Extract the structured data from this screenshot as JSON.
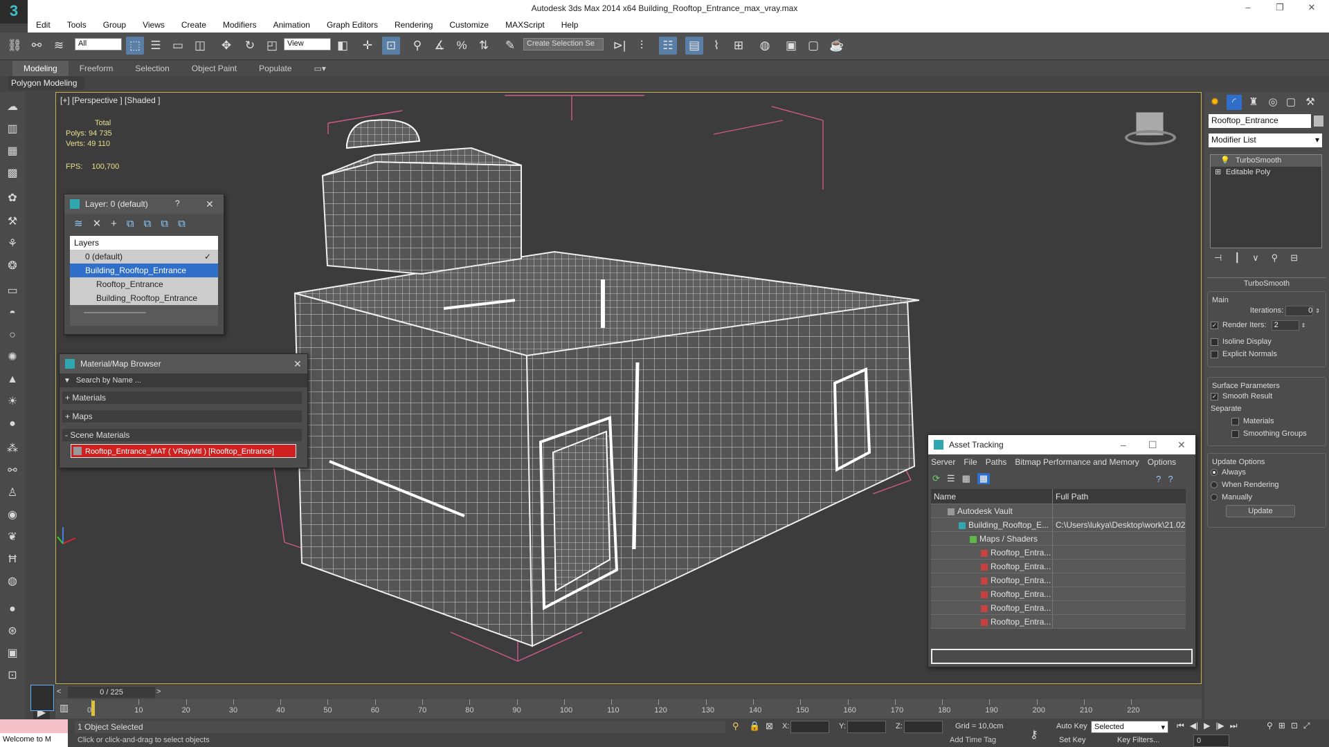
{
  "app": {
    "title": "Autodesk 3ds Max  2014 x64    Building_Rooftop_Entrance_max_vray.max",
    "logo": "3"
  },
  "menu": [
    "Edit",
    "Tools",
    "Group",
    "Views",
    "Create",
    "Modifiers",
    "Animation",
    "Graph Editors",
    "Rendering",
    "Customize",
    "MAXScript",
    "Help"
  ],
  "toolbar": {
    "filter": "All",
    "ref_coord": "View",
    "selection_set": "Create Selection Se"
  },
  "ribbon": {
    "tabs": [
      "Modeling",
      "Freeform",
      "Selection",
      "Object Paint",
      "Populate"
    ],
    "sub_label": "Polygon Modeling"
  },
  "viewport": {
    "label": "[+] [Perspective ] [Shaded ]",
    "stats_total": "Total",
    "polys_label": "Polys:",
    "polys_value": "94 735",
    "verts_label": "Verts:",
    "verts_value": "49 110",
    "fps_label": "FPS:",
    "fps_value": "100,700"
  },
  "layer_panel": {
    "title": "Layer: 0 (default)",
    "help": "?",
    "header": "Layers",
    "items": [
      "0 (default)",
      "Building_Rooftop_Entrance",
      "Rooftop_Entrance",
      "Building_Rooftop_Entrance"
    ]
  },
  "material_browser": {
    "title": "Material/Map Browser",
    "search_placeholder": "Search by Name ...",
    "sections": [
      "+ Materials",
      "+ Maps",
      "- Scene Materials"
    ],
    "scene_material": "Rooftop_Entrance_MAT  ( VRayMtl )  [Rooftop_Entrance]"
  },
  "asset_tracking": {
    "title": "Asset Tracking",
    "menu": [
      "Server",
      "File",
      "Paths",
      "Bitmap Performance and Memory",
      "Options"
    ],
    "columns": [
      "Name",
      "Full Path"
    ],
    "rows": [
      {
        "name": "Autodesk Vault",
        "path": ""
      },
      {
        "name": "Building_Rooftop_E...",
        "path": "C:\\Users\\lukya\\Desktop\\work\\21.02"
      },
      {
        "name": "Maps / Shaders",
        "path": ""
      },
      {
        "name": "Rooftop_Entra...",
        "path": ""
      },
      {
        "name": "Rooftop_Entra...",
        "path": ""
      },
      {
        "name": "Rooftop_Entra...",
        "path": ""
      },
      {
        "name": "Rooftop_Entra...",
        "path": ""
      },
      {
        "name": "Rooftop_Entra...",
        "path": ""
      },
      {
        "name": "Rooftop_Entra...",
        "path": ""
      }
    ]
  },
  "command_panel": {
    "object_name": "Rooftop_Entrance",
    "modifier_list": "Modifier List",
    "stack": [
      "TurboSmooth",
      "Editable Poly"
    ],
    "rollout_title": "TurboSmooth",
    "main_label": "Main",
    "iterations_label": "Iterations:",
    "iterations_value": "0",
    "render_iters_label": "Render Iters:",
    "render_iters_value": "2",
    "isoline": "Isoline Display",
    "explicit_normals": "Explicit Normals",
    "surface_params": "Surface Parameters",
    "smooth_result": "Smooth Result",
    "separate": "Separate",
    "materials": "Materials",
    "smoothing_groups": "Smoothing Groups",
    "update_options": "Update Options",
    "always": "Always",
    "when_rendering": "When Rendering",
    "manually": "Manually",
    "update_btn": "Update"
  },
  "timeline": {
    "frame": "0 / 225",
    "ticks": [
      "0",
      "10",
      "20",
      "30",
      "40",
      "50",
      "60",
      "70",
      "80",
      "90",
      "100",
      "110",
      "120",
      "130",
      "140",
      "150",
      "160",
      "170",
      "180",
      "190",
      "200",
      "210",
      "220"
    ]
  },
  "status": {
    "selected": "1 Object Selected",
    "hint": "Click or click-and-drag to select objects",
    "maxscript": "Welcome to M",
    "x_label": "X:",
    "y_label": "Y:",
    "z_label": "Z:",
    "grid": "Grid = 10,0cm",
    "auto_key": "Auto Key",
    "set_key": "Set Key",
    "key_mode": "Selected",
    "key_filters": "Key Filters...",
    "add_time_tag": "Add Time Tag",
    "frame_field": "0"
  },
  "colors": {
    "selection_blue": "#2f6ec9",
    "highlight_red": "#d02020",
    "viewport_border": "#c9b24a",
    "bbox_pink": "#d05a8a"
  }
}
